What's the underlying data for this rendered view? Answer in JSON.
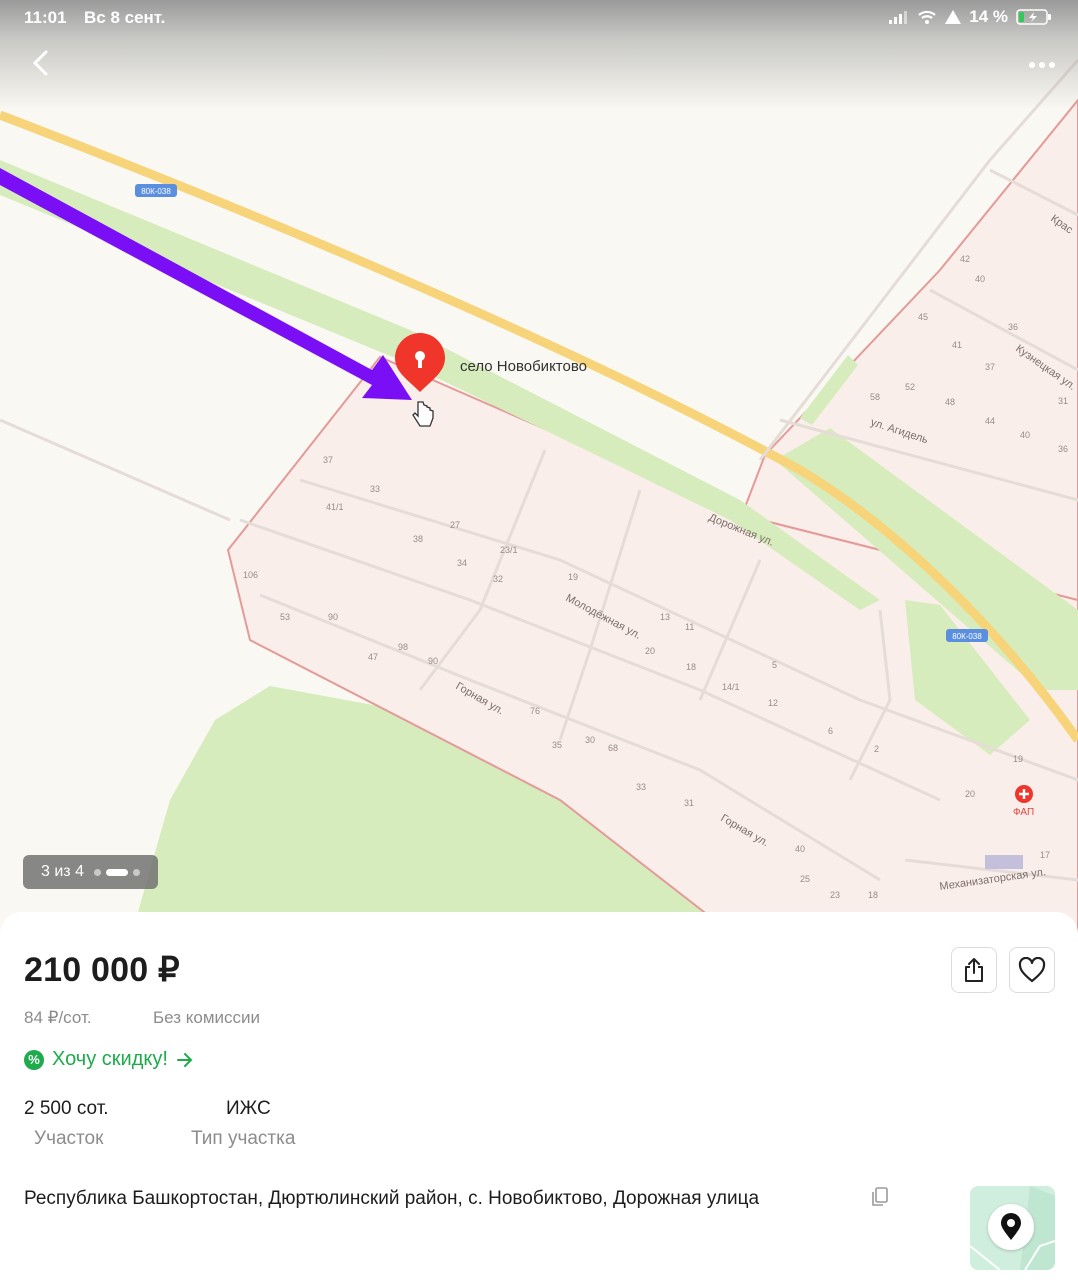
{
  "status_bar": {
    "time": "11:01",
    "date": "Вс 8 сент.",
    "battery": "14 %"
  },
  "map": {
    "village_label": "село Новобиктово",
    "road_badge": "80К-038",
    "streets": [
      "ул. Агидель",
      "Дорожная ул.",
      "Молодёжная ул.",
      "Горная ул.",
      "Механизаторская ул.",
      "Кузнецкая ул.",
      "Крас"
    ],
    "poi": "ФАП",
    "house_numbers": [
      "42",
      "40",
      "45",
      "41",
      "37",
      "36",
      "58",
      "52",
      "48",
      "44",
      "40",
      "36",
      "31",
      "37",
      "33",
      "41/1",
      "27",
      "38",
      "34",
      "23/1",
      "32",
      "19",
      "13",
      "11",
      "5",
      "106",
      "53",
      "90",
      "47",
      "98",
      "90",
      "20",
      "18",
      "14/1",
      "12",
      "6",
      "2",
      "76",
      "35",
      "30",
      "68",
      "33",
      "31",
      "40",
      "25",
      "23",
      "18",
      "19",
      "20",
      "17"
    ],
    "colors": {
      "arrow": "#7a0ff5",
      "pin": "#f0352b",
      "road": "#f7d37a",
      "green": "#d7ecbd",
      "settlement": "#faeeea",
      "border": "#e39a98"
    }
  },
  "gallery": {
    "counter": "3 из 4",
    "total": 4,
    "active_index": 3
  },
  "listing": {
    "price": "210 000 ₽",
    "price_per_unit": "84 ₽/сот.",
    "commission": "Без комиссии",
    "discount_link": "Хочу скидку!",
    "params": [
      {
        "value": "2 500 сот.",
        "label": "Участок"
      },
      {
        "value": "ИЖС",
        "label": "Тип участка"
      }
    ],
    "address": "Республика Башкортостан, Дюртюлинский район, с. Новобиктово, Дорожная улица"
  },
  "icons": {
    "back": "chevron-left-icon",
    "more": "more-dots-icon",
    "share": "share-icon",
    "favorite": "heart-icon",
    "copy": "copy-icon",
    "location": "location-pin-icon",
    "discount": "percent-icon"
  }
}
